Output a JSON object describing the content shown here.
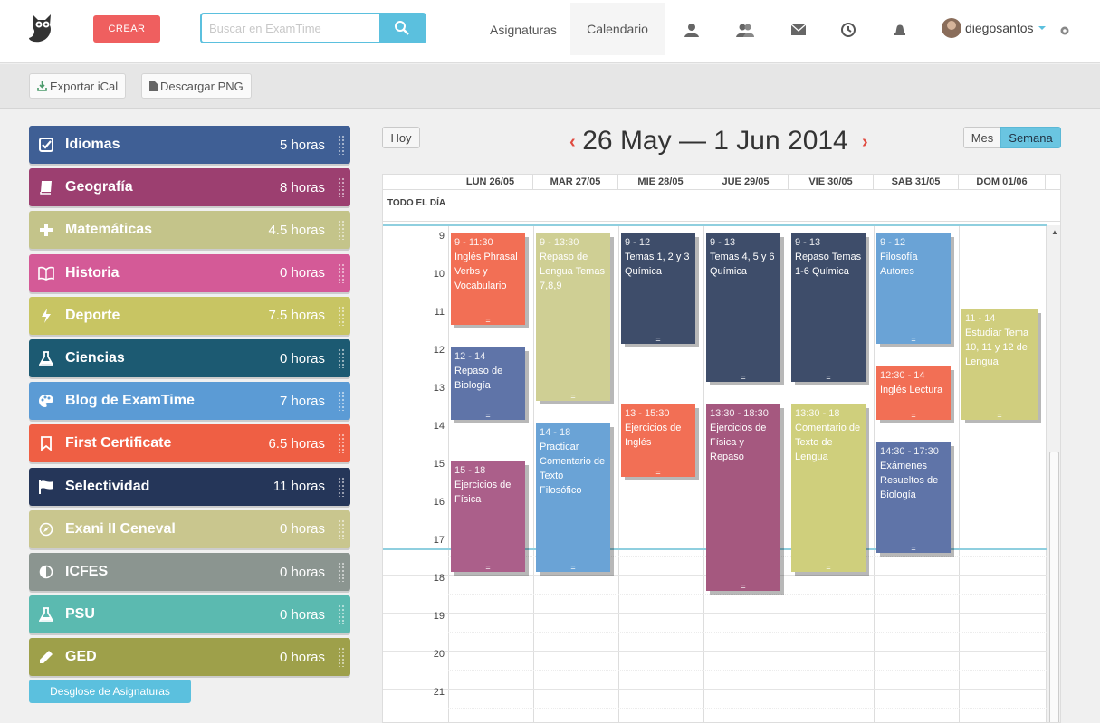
{
  "nav": {
    "crear": "CREAR",
    "search_placeholder": "Buscar en ExamTime",
    "asignaturas": "Asignaturas",
    "calendario": "Calendario",
    "username": "diegosantos"
  },
  "toolbar": {
    "export_ical": "Exportar iCal",
    "download_png": "Descargar PNG"
  },
  "subjects": [
    {
      "name": "Idiomas",
      "hours": "5 horas",
      "color": "#3f5f95",
      "icon": "check-square-icon"
    },
    {
      "name": "Geografía",
      "hours": "8 horas",
      "color": "#9c3f70",
      "icon": "book-icon"
    },
    {
      "name": "Matemáticas",
      "hours": "4.5 horas",
      "color": "#c4c48a",
      "icon": "plus-icon"
    },
    {
      "name": "Historia",
      "hours": "0 horas",
      "color": "#d45a97",
      "icon": "open-book-icon"
    },
    {
      "name": "Deporte",
      "hours": "7.5 horas",
      "color": "#c8c563",
      "icon": "bolt-icon"
    },
    {
      "name": "Ciencias",
      "hours": "0 horas",
      "color": "#1c5a72",
      "icon": "flask-icon"
    },
    {
      "name": "Blog de ExamTime",
      "hours": "7 horas",
      "color": "#5b9bd5",
      "icon": "palette-icon"
    },
    {
      "name": "First Certificate",
      "hours": "6.5 horas",
      "color": "#ef5f44",
      "icon": "bookmark-icon"
    },
    {
      "name": "Selectividad",
      "hours": "11 horas",
      "color": "#253659",
      "icon": "flag-icon"
    },
    {
      "name": "Exani II Ceneval",
      "hours": "0 horas",
      "color": "#c9c68e",
      "icon": "compass-icon"
    },
    {
      "name": "ICFES",
      "hours": "0 horas",
      "color": "#8b9590",
      "icon": "contrast-icon"
    },
    {
      "name": "PSU",
      "hours": "0 horas",
      "color": "#5bbab0",
      "icon": "flask-icon"
    },
    {
      "name": "GED",
      "hours": "0 horas",
      "color": "#9ea04a",
      "icon": "pencil-icon"
    }
  ],
  "desglose": "Desglose de Asignaturas",
  "calendar": {
    "today_button": "Hoy",
    "range_title": "26 May — 1 Jun 2014",
    "view_month": "Mes",
    "view_week": "Semana",
    "all_day_label": "TODO EL DÍA",
    "days": [
      "LUN 26/05",
      "MAR 27/05",
      "MIE 28/05",
      "JUE 29/05",
      "VIE 30/05",
      "SAB 31/05",
      "DOM 01/06"
    ],
    "hours": [
      "9",
      "10",
      "11",
      "12",
      "13",
      "14",
      "15",
      "16",
      "17",
      "18",
      "19",
      "20",
      "21"
    ],
    "events": [
      {
        "day": 0,
        "start": 9,
        "end": 11.5,
        "time": "9 - 11:30",
        "title": "Inglés Phrasal Verbs y Vocabulario",
        "color": "#f26f55"
      },
      {
        "day": 0,
        "start": 12,
        "end": 14,
        "time": "12 - 14",
        "title": "Repaso de Biología",
        "color": "#5f74a8"
      },
      {
        "day": 0,
        "start": 15,
        "end": 18,
        "time": "15 - 18",
        "title": "Ejercicios de Física",
        "color": "#ab5f8a"
      },
      {
        "day": 1,
        "start": 9,
        "end": 13.5,
        "time": "9 - 13:30",
        "title": "Repaso de Lengua Temas 7,8,9",
        "color": "#cfcf94"
      },
      {
        "day": 1,
        "start": 14,
        "end": 18,
        "time": "14 - 18",
        "title": "Practicar Comentario de Texto Filosófico",
        "color": "#6aa3d6"
      },
      {
        "day": 2,
        "start": 9,
        "end": 12,
        "time": "9 - 12",
        "title": "Temas 1, 2 y 3 Química",
        "color": "#3e4d6a"
      },
      {
        "day": 2,
        "start": 13.5,
        "end": 15.5,
        "time": "13 - 15:30",
        "title": "Ejercicios de Inglés",
        "color": "#f26f55"
      },
      {
        "day": 3,
        "start": 9,
        "end": 13,
        "time": "9 - 13",
        "title": "Temas 4, 5 y 6 Química",
        "color": "#3e4d6a"
      },
      {
        "day": 3,
        "start": 13.5,
        "end": 18.5,
        "time": "13:30 - 18:30",
        "title": "Ejercicios de Física y Repaso",
        "color": "#a5587f"
      },
      {
        "day": 4,
        "start": 9,
        "end": 13,
        "time": "9 - 13",
        "title": "Repaso Temas 1-6 Química",
        "color": "#3e4d6a"
      },
      {
        "day": 4,
        "start": 13.5,
        "end": 18,
        "time": "13:30 - 18",
        "title": "Comentario de Texto de Lengua",
        "color": "#cfcf7c"
      },
      {
        "day": 5,
        "start": 9,
        "end": 12,
        "time": "9 - 12",
        "title": "Filosofía Autores",
        "color": "#6aa3d6"
      },
      {
        "day": 5,
        "start": 12.5,
        "end": 14,
        "time": "12:30 - 14",
        "title": "Inglés Lectura",
        "color": "#f26f55"
      },
      {
        "day": 5,
        "start": 14.5,
        "end": 17.5,
        "time": "14:30 - 17:30",
        "title": "Exámenes Resueltos de Biología",
        "color": "#5f74a8"
      },
      {
        "day": 6,
        "start": 11,
        "end": 14,
        "time": "11 - 14",
        "title": "Estudiar Tema 10, 11 y 12 de Lengua",
        "color": "#d0ce7e"
      }
    ]
  }
}
